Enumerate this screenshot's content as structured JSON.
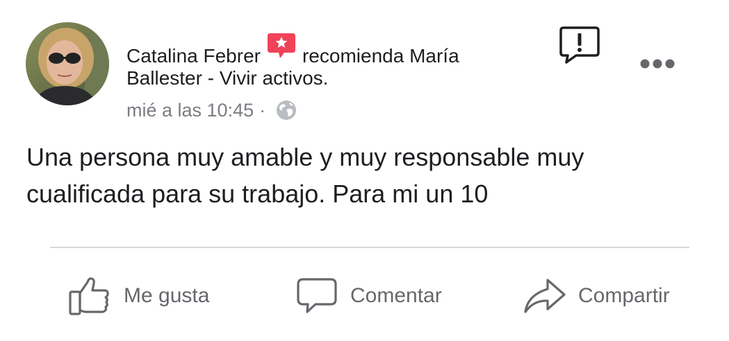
{
  "post": {
    "author": "Catalina Febrer",
    "action_text": "recomienda María",
    "page_name": "Ballester - Vivir activos.",
    "timestamp": "mié a las 10:45",
    "separator": "·",
    "body": "Una persona muy amable y muy responsable muy cualificada para su trabajo. Para mi un 10"
  },
  "actions": {
    "like_label": "Me gusta",
    "comment_label": "Comentar",
    "share_label": "Compartir"
  },
  "icons": {
    "badge": "recommendation-star-icon",
    "audience": "globe-icon",
    "report": "report-icon",
    "more": "more-options-icon"
  },
  "colors": {
    "recommend_badge": "#f0435a",
    "secondary_text": "#65676b"
  }
}
